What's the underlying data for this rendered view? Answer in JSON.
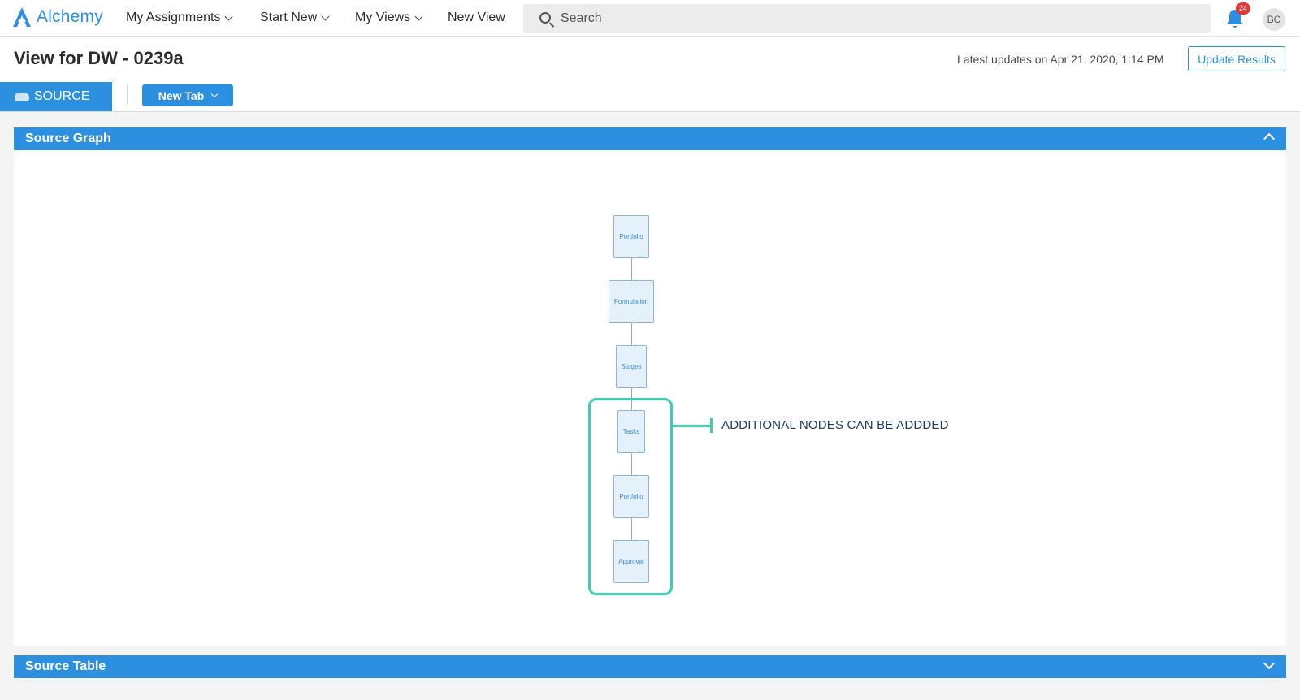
{
  "app": {
    "name": "Alchemy",
    "brand_color": "#2d8fe0"
  },
  "nav": {
    "items": [
      {
        "label": "My Assignments"
      },
      {
        "label": "Start New"
      },
      {
        "label": "My Views"
      },
      {
        "label": "New View"
      }
    ],
    "search_placeholder": "Search",
    "notifications_count": "24",
    "user_initials": "BC"
  },
  "header": {
    "title": "View for DW - 0239a",
    "latest_updates": "Latest updates on Apr 21, 2020, 1:14 PM",
    "update_button": "Update Results",
    "tabs": [
      {
        "label": "SOURCE",
        "active": true
      }
    ],
    "new_tab_button": "New Tab"
  },
  "panels": {
    "source_graph": {
      "title": "Source Graph",
      "expanded": true
    },
    "source_table": {
      "title": "Source Table",
      "expanded": false
    }
  },
  "graph": {
    "nodes": [
      "Portfolio",
      "Formulation",
      "Stages",
      "Tasks",
      "Portfolio",
      "Approval"
    ],
    "callout": "ADDITIONAL NODES CAN BE ADDDED",
    "highlight_color": "#3ecfb0"
  }
}
